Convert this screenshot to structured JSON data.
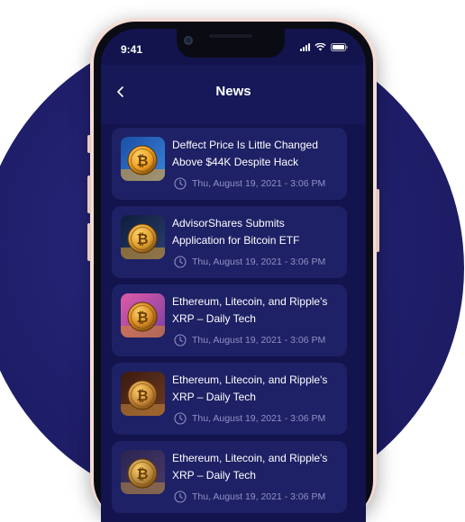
{
  "status_bar": {
    "time": "9:41"
  },
  "header": {
    "title": "News"
  },
  "news": [
    {
      "title": "Deffect Price Is Little Changed Above $44K Despite Hack",
      "date": "Thu, August 19, 2021 - 3:06 PM",
      "thumb": "bitcoin-coin-icon"
    },
    {
      "title": "AdvisorShares Submits Application for Bitcoin ETF",
      "date": "Thu, August 19, 2021 - 3:06 PM",
      "thumb": "bitcoin-coin-icon"
    },
    {
      "title": "Ethereum, Litecoin, and Ripple's XRP – Daily Tech",
      "date": "Thu, August 19, 2021 - 3:06 PM",
      "thumb": "bitcoin-coin-icon"
    },
    {
      "title": "Ethereum, Litecoin, and Ripple's XRP – Daily Tech",
      "date": "Thu, August 19, 2021 - 3:06 PM",
      "thumb": "bitcoin-coin-icon"
    },
    {
      "title": "Ethereum, Litecoin, and Ripple's XRP – Daily Tech",
      "date": "Thu, August 19, 2021 - 3:06 PM",
      "thumb": "bitcoin-coin-icon"
    }
  ],
  "colors": {
    "background_circle": "#1f1e6a",
    "screen": "#13144e",
    "card": "#1e2165",
    "meta_text": "#8f92c4",
    "phone_frame": "#f4dcd4"
  }
}
